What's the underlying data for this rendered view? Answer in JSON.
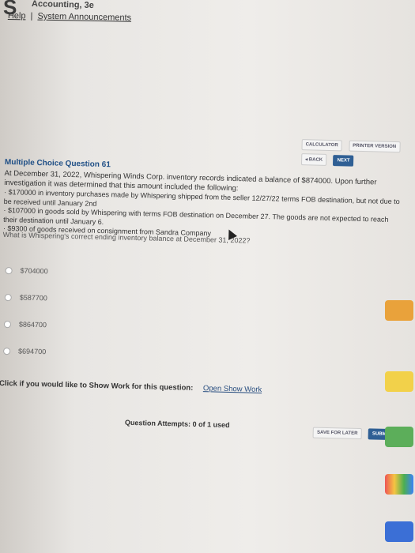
{
  "header": {
    "corner_letter": "S",
    "top_text": "Accounting, 3e",
    "help": "Help",
    "separator": "|",
    "system_announcements": "System Announcements"
  },
  "toolbar": {
    "calculator": "CALCULATOR",
    "printer_version": "PRINTER VERSION",
    "back": "◂ BACK",
    "next": "NEXT"
  },
  "question": {
    "title": "Multiple Choice Question 61",
    "text": "At December 31, 2022, Whispering Winds Corp. inventory records indicated a balance of $874000. Upon further investigation it was determined that this amount included the following:",
    "bullets": [
      "· $170000 in inventory purchases made by Whispering shipped from the seller 12/27/22 terms FOB destination, but not due to be received until January 2nd",
      "· $107000 in goods sold by Whispering with terms FOB destination on December 27. The goods are not expected to reach their destination until January 6.",
      "· $9300 of goods received on consignment from Sandra Company"
    ],
    "prompt": "What is Whispering's correct ending inventory balance at December 31, 2022?"
  },
  "options": [
    {
      "label": "$704000"
    },
    {
      "label": "$587700"
    },
    {
      "label": "$864700"
    },
    {
      "label": "$694700"
    }
  ],
  "show_work": {
    "text": "Click if you would like to Show Work for this question:",
    "link": "Open Show Work"
  },
  "footer": {
    "attempts": "Question Attempts: 0 of 1 used",
    "save_for_later": "SAVE FOR LATER",
    "submit_answer": "SUBMIT ANSW"
  },
  "colors": {
    "link_blue": "#1f4f86",
    "primary_button": "#2f5f94",
    "page_background": "#efedea"
  }
}
